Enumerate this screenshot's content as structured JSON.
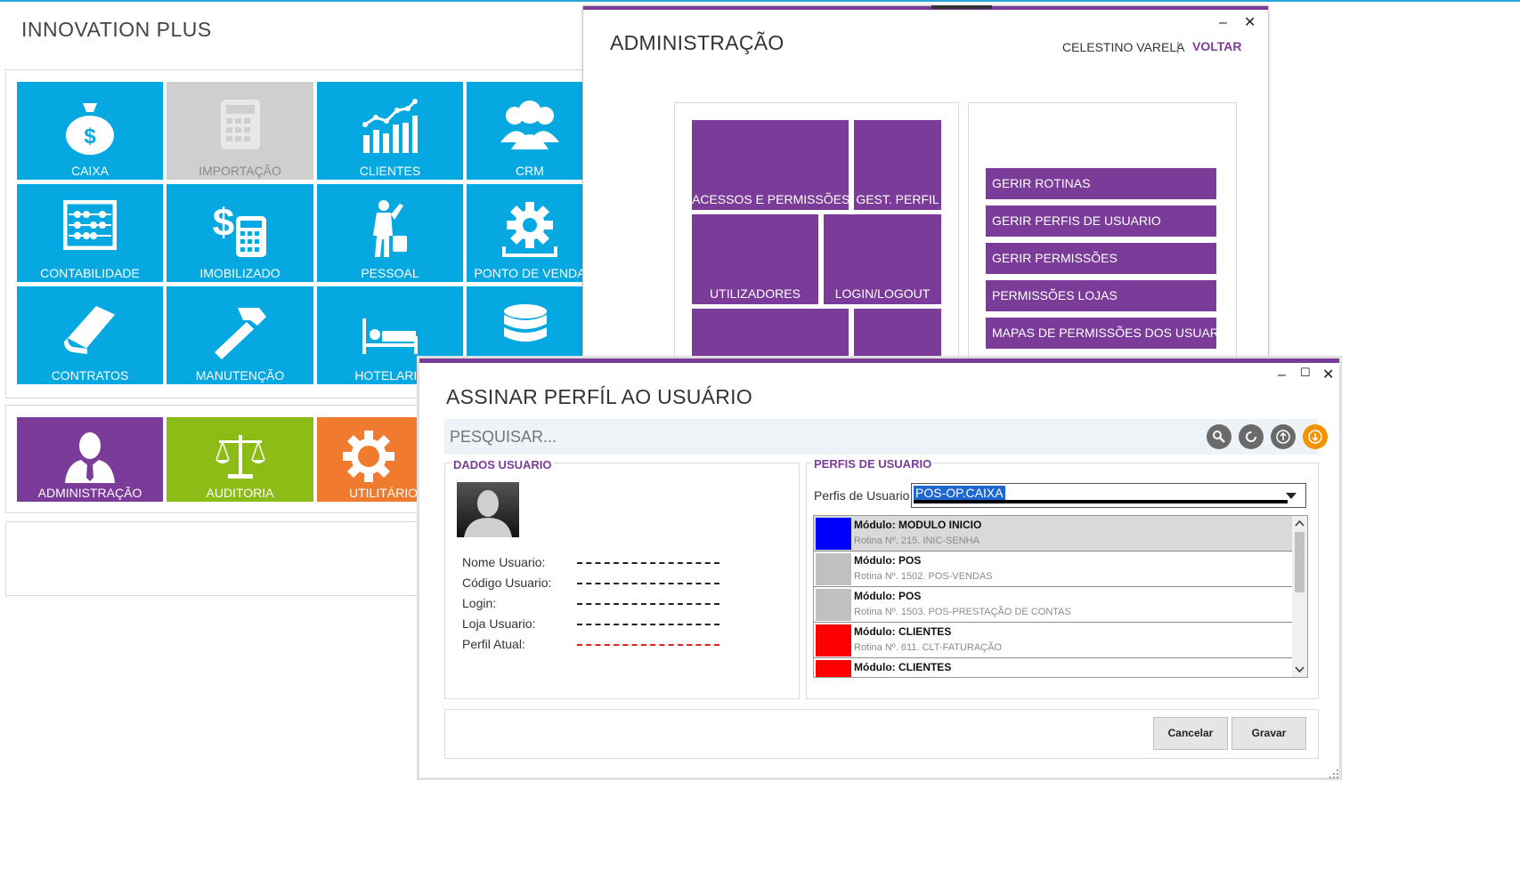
{
  "app": {
    "title": "INNOVATION PLUS"
  },
  "main_tiles": [
    {
      "label": "CAIXA"
    },
    {
      "label": "IMPORTAÇÃO"
    },
    {
      "label": "CLIENTES"
    },
    {
      "label": "CRM"
    },
    {
      "label": "CONTABILIDADE"
    },
    {
      "label": "IMOBILIZADO"
    },
    {
      "label": "PESSOAL"
    },
    {
      "label": "PONTO DE VENDA"
    },
    {
      "label": "CONTRATOS"
    },
    {
      "label": "MANUTENÇÃO"
    },
    {
      "label": "HOTELARIA"
    },
    {
      "label": ""
    }
  ],
  "bottom_tiles": [
    {
      "label": "ADMINISTRAÇÃO"
    },
    {
      "label": "AUDITORIA"
    },
    {
      "label": "UTILITÁRIO"
    }
  ],
  "admin": {
    "title": "ADMINISTRAÇÃO",
    "user": "CELESTINO VARELA",
    "separator": "|",
    "back": "VOLTAR",
    "tiles": [
      {
        "label": "ACESSOS E PERMISSÕES"
      },
      {
        "label": "GEST. PERFIL"
      },
      {
        "label": "UTILIZADORES"
      },
      {
        "label": "LOGIN/LOGOUT"
      }
    ],
    "buttons": [
      "GERIR ROTINAS",
      "GERIR PERFIS DE USUARIO",
      "GERIR PERMISSÕES",
      "PERMISSÕES LOJAS",
      "MAPAS DE PERMISSÕES DOS USUARI..."
    ]
  },
  "dialog": {
    "title": "ASSINAR PERFÍL AO USUÁRIO",
    "search_placeholder": "PESQUISAR...",
    "user_section": {
      "title": "DADOS USUARIO",
      "fields": [
        {
          "label": "Nome Usuario:"
        },
        {
          "label": "Código Usuario:"
        },
        {
          "label": "Login:"
        },
        {
          "label": "Loja Usuario:"
        },
        {
          "label": "Perfil Atual:"
        }
      ]
    },
    "profiles_section": {
      "title": "PERFIS DE USUARIO",
      "profile_label": "Perfis de Usuario",
      "profile_value": "POS-OP.CAIXA",
      "rows": [
        {
          "module": "Módulo: MODULO INICIO",
          "routine": "Rotina Nº. 215. INIC-SENHA",
          "color": "#0000ff"
        },
        {
          "module": "Módulo: POS",
          "routine": "Rotina Nº. 1502. POS-VENDAS",
          "color": "#c0c0c0"
        },
        {
          "module": "Módulo: POS",
          "routine": "Rotina Nº. 1503. POS-PRESTAÇÃO DE CONTAS",
          "color": "#c0c0c0"
        },
        {
          "module": "Módulo: CLIENTES",
          "routine": "Rotina Nº. 611. CLT-FATURAÇÃO",
          "color": "#ff0000"
        },
        {
          "module": "Módulo: CLIENTES",
          "routine": "",
          "color": "#ff0000"
        }
      ]
    },
    "buttons": {
      "cancel": "Cancelar",
      "save": "Gravar"
    }
  },
  "colors": {
    "accent": "#7b3c99",
    "tile_blue": "#05a8e0",
    "green": "#8dbc17",
    "orange": "#f07a2d"
  }
}
